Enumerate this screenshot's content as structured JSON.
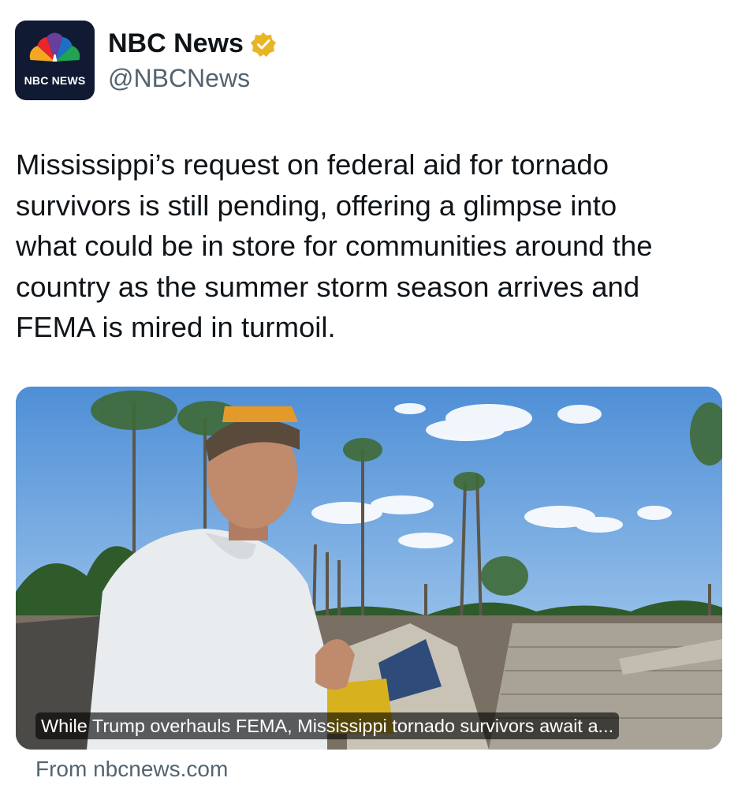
{
  "author": {
    "display_name": "NBC News",
    "handle": "@NBCNews",
    "verified_icon": "gold-verified-badge-icon",
    "avatar_text": "NBC NEWS",
    "brand_colors": [
      "#f5a623",
      "#e8262c",
      "#6a3e9b",
      "#1f6fc5",
      "#20a352",
      "#f06a1f"
    ]
  },
  "tweet": {
    "text": "Mississippi’s request on federal aid for tornado\nsurvivors is still pending, offering a glimpse into\nwhat could be in store for communities around the\ncountry as the summer storm season arrives and\nFEMA is mired in turmoil."
  },
  "link_card": {
    "image": "photo-man-in-tornado-debris",
    "caption": "While Trump overhauls FEMA, Mississippi tornado survivors await a...",
    "source": "From nbcnews.com"
  }
}
